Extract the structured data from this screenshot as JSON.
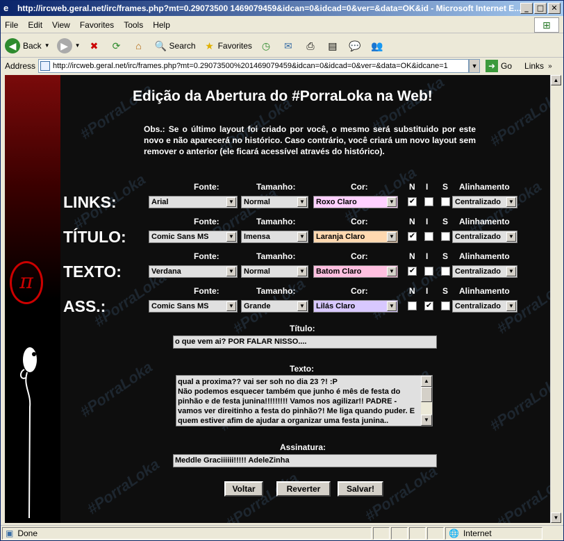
{
  "window": {
    "title": "http://ircweb.geral.net/irc/frames.php?mt=0.29073500 1469079459&idcan=0&idcad=0&ver=&data=OK&id - Microsoft Internet E...",
    "minimize": "_",
    "maximize": "□",
    "close": "✕"
  },
  "menu": [
    "File",
    "Edit",
    "View",
    "Favorites",
    "Tools",
    "Help"
  ],
  "toolbar": {
    "back": "Back",
    "search": "Search",
    "favorites": "Favorites"
  },
  "address": {
    "label": "Address",
    "url": "http://ircweb.geral.net/irc/frames.php?mt=0.29073500%201469079459&idcan=0&idcad=0&ver=&data=OK&idcane=1",
    "go": "Go",
    "links": "Links"
  },
  "watermark": "#PorraLoka",
  "page": {
    "heading": "Edição da Abertura do #PorraLoka na Web!",
    "obs": "Obs.: Se o último layout foi criado por você, o mesmo será substituido por este novo e não aparecerá no histórico. Caso contrário, você criará um novo layout sem remover o anterior (ele ficará acessível através do histórico).",
    "col_fonte": "Fonte:",
    "col_tamanho": "Tamanho:",
    "col_cor": "Cor:",
    "col_n": "N",
    "col_i": "I",
    "col_s": "S",
    "col_alinhamento": "Alinhamento",
    "rows": [
      {
        "label": "LINKS:",
        "fonte": "Arial",
        "tamanho": "Normal",
        "cor": "Roxo Claro",
        "cor_hex": "#ffd0ff",
        "n": true,
        "i": false,
        "s": false,
        "alinhamento": "Centralizado"
      },
      {
        "label": "TÍTULO:",
        "fonte": "Comic Sans MS",
        "tamanho": "Imensa",
        "cor": "Laranja Claro",
        "cor_hex": "#ffd8b0",
        "n": true,
        "i": false,
        "s": false,
        "alinhamento": "Centralizado"
      },
      {
        "label": "TEXTO:",
        "fonte": "Verdana",
        "tamanho": "Normal",
        "cor": "Batom Claro",
        "cor_hex": "#ffc0e0",
        "n": true,
        "i": false,
        "s": false,
        "alinhamento": "Centralizado"
      },
      {
        "label": "ASS.:",
        "fonte": "Comic Sans MS",
        "tamanho": "Grande",
        "cor": "Lilás Claro",
        "cor_hex": "#d8c8ff",
        "n": false,
        "i": true,
        "s": false,
        "alinhamento": "Centralizado"
      }
    ],
    "titulo_label": "Título:",
    "titulo_value": "o que vem ai? POR FALAR NISSO....",
    "texto_label": "Texto:",
    "texto_value": "qual a proxima?? vai ser soh no dia 23 ?! :P\nNão podemos esquecer também que junho é mês de festa do pinhão e de festa junina!!!!!!!!! Vamos nos agilizar!! PADRE - vamos ver direitinho a festa do pinhão?! Me liga quando puder. E quem estiver afim de ajudar a organizar uma festa junina..",
    "assinatura_label": "Assinatura:",
    "assinatura_value": "Meddle Graciiiiii!!!!!  AdeleZinha",
    "btn_voltar": "Voltar",
    "btn_reverter": "Reverter",
    "btn_salvar": "Salvar!"
  },
  "status": {
    "text": "Done",
    "zone": "Internet"
  }
}
